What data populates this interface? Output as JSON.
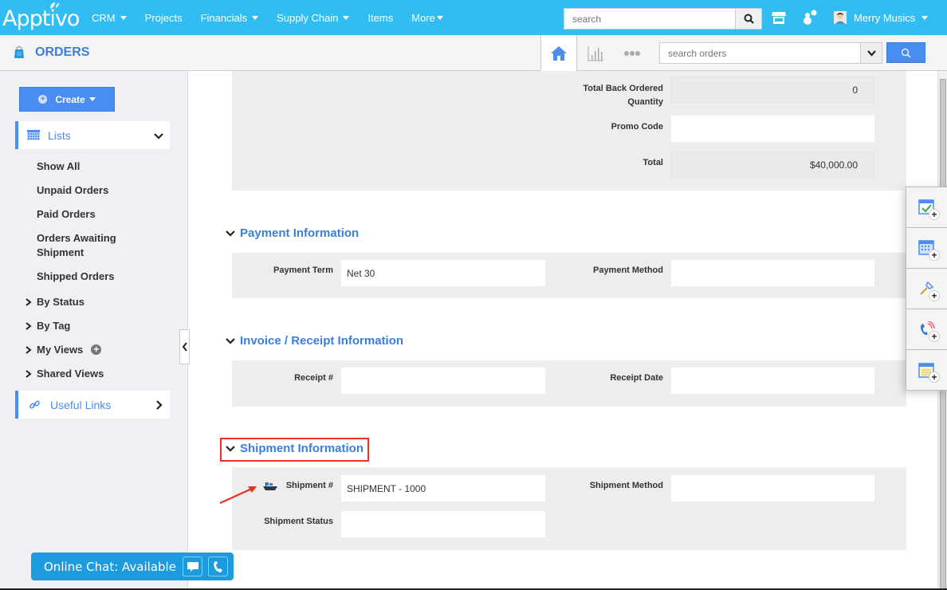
{
  "topbar": {
    "logo": "Apptivo",
    "nav": [
      {
        "label": "CRM",
        "dropdown": true
      },
      {
        "label": "Projects",
        "dropdown": false
      },
      {
        "label": "Financials",
        "dropdown": true
      },
      {
        "label": "Supply Chain",
        "dropdown": true
      },
      {
        "label": "Items",
        "dropdown": false
      },
      {
        "label": "More",
        "dropdown": true
      }
    ],
    "search_placeholder": "search",
    "user_name": "Merry Musics",
    "colors": {
      "bar": "#31bdf1",
      "accent": "#4a8df0"
    }
  },
  "subbar": {
    "app_title": "ORDERS",
    "search_placeholder": "search orders"
  },
  "sidebar": {
    "create_label": "Create",
    "lists_label": "Lists",
    "list_links": [
      "Show All",
      "Unpaid Orders",
      "Paid Orders",
      "Orders Awaiting Shipment",
      "Shipped Orders"
    ],
    "expandables": [
      "By Status",
      "By Tag",
      "My Views",
      "Shared Views"
    ],
    "useful_links_label": "Useful Links"
  },
  "summary": {
    "back_ordered_label": "Total Back Ordered Quantity",
    "back_ordered_value": "0",
    "promo_label": "Promo Code",
    "promo_value": "",
    "total_label": "Total",
    "total_value": "$40,000.00"
  },
  "payment": {
    "title": "Payment Information",
    "term_label": "Payment Term",
    "term_value": "Net 30",
    "method_label": "Payment Method",
    "method_value": ""
  },
  "invoice": {
    "title": "Invoice / Receipt Information",
    "receipt_label": "Receipt #",
    "receipt_value": "",
    "date_label": "Receipt Date",
    "date_value": ""
  },
  "shipment": {
    "title": "Shipment Information",
    "number_label": "Shipment #",
    "number_value": "SHIPMENT - 1000",
    "method_label": "Shipment Method",
    "method_value": "",
    "status_label": "Shipment Status",
    "status_value": ""
  },
  "widget": {
    "items": [
      "add-task-icon",
      "add-event-icon",
      "add-follow-up-icon",
      "add-call-log-icon",
      "add-note-icon"
    ]
  },
  "chat": {
    "label": "Online Chat: Available"
  }
}
